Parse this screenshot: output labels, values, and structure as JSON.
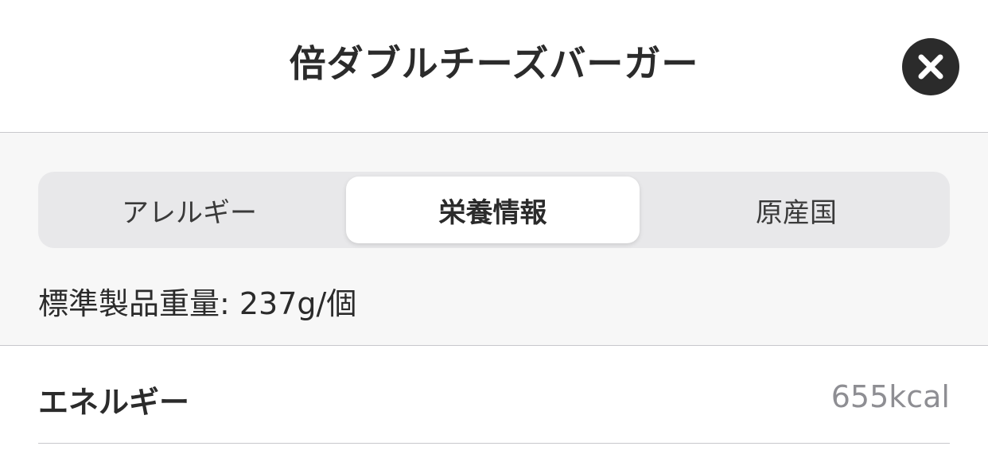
{
  "header": {
    "title": "倍ダブルチーズバーガー",
    "close_icon": "close-icon"
  },
  "tabs": {
    "items": [
      {
        "label": "アレルギー",
        "selected": false
      },
      {
        "label": "栄養情報",
        "selected": true
      },
      {
        "label": "原産国",
        "selected": false
      }
    ]
  },
  "product": {
    "weight_text": "標準製品重量: 237g/個"
  },
  "nutrition": {
    "rows": [
      {
        "label": "エネルギー",
        "value": "655kcal"
      }
    ]
  },
  "colors": {
    "text_dark": "#2b2b2b",
    "value_gray": "#8e8e93",
    "segment_bg": "#e8e8ea",
    "upper_bg": "#f7f7f7"
  }
}
